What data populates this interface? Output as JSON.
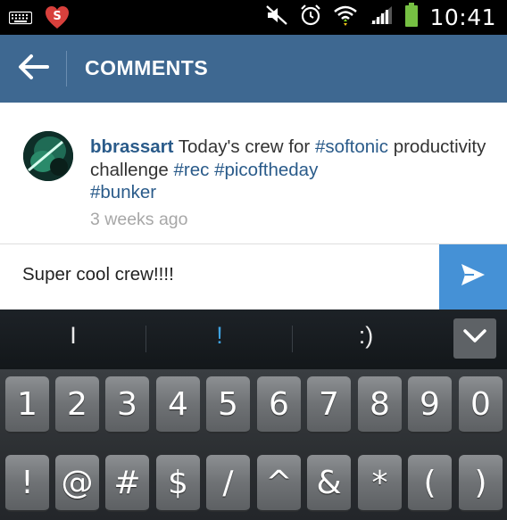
{
  "status_bar": {
    "time": "10:41",
    "icons": [
      "keyboard-icon",
      "softonic-heart-icon",
      "mute-icon",
      "alarm-icon",
      "wifi-icon",
      "signal-icon",
      "battery-icon"
    ],
    "accent_color": "#d8403c"
  },
  "action_bar": {
    "title": "COMMENTS",
    "back_icon": "back-arrow-icon",
    "color": "#3e6891"
  },
  "post": {
    "username": "bbrassart",
    "caption_plain_1": " Today's crew for ",
    "tag_softonic": "#softonic",
    "caption_plain_2": " productivity challenge ",
    "tag_rec": "#rec",
    "space": " ",
    "tag_picoftheday": "#picoftheday",
    "tag_bunker": "#bunker",
    "timestamp": "3 weeks ago"
  },
  "comment_input": {
    "value": "Super cool crew!!!!",
    "send_icon": "send-icon",
    "send_color": "#4591d6"
  },
  "suggestions": {
    "items": [
      "I",
      "!",
      ":)"
    ],
    "highlight_color": "#3fa2e0",
    "collapse_icon": "chevron-down-icon"
  },
  "keyboard": {
    "row1": [
      "1",
      "2",
      "3",
      "4",
      "5",
      "6",
      "7",
      "8",
      "9",
      "0"
    ],
    "row2": [
      "!",
      "@",
      "#",
      "$",
      "/",
      "^",
      "&",
      "*",
      "(",
      ")"
    ]
  }
}
